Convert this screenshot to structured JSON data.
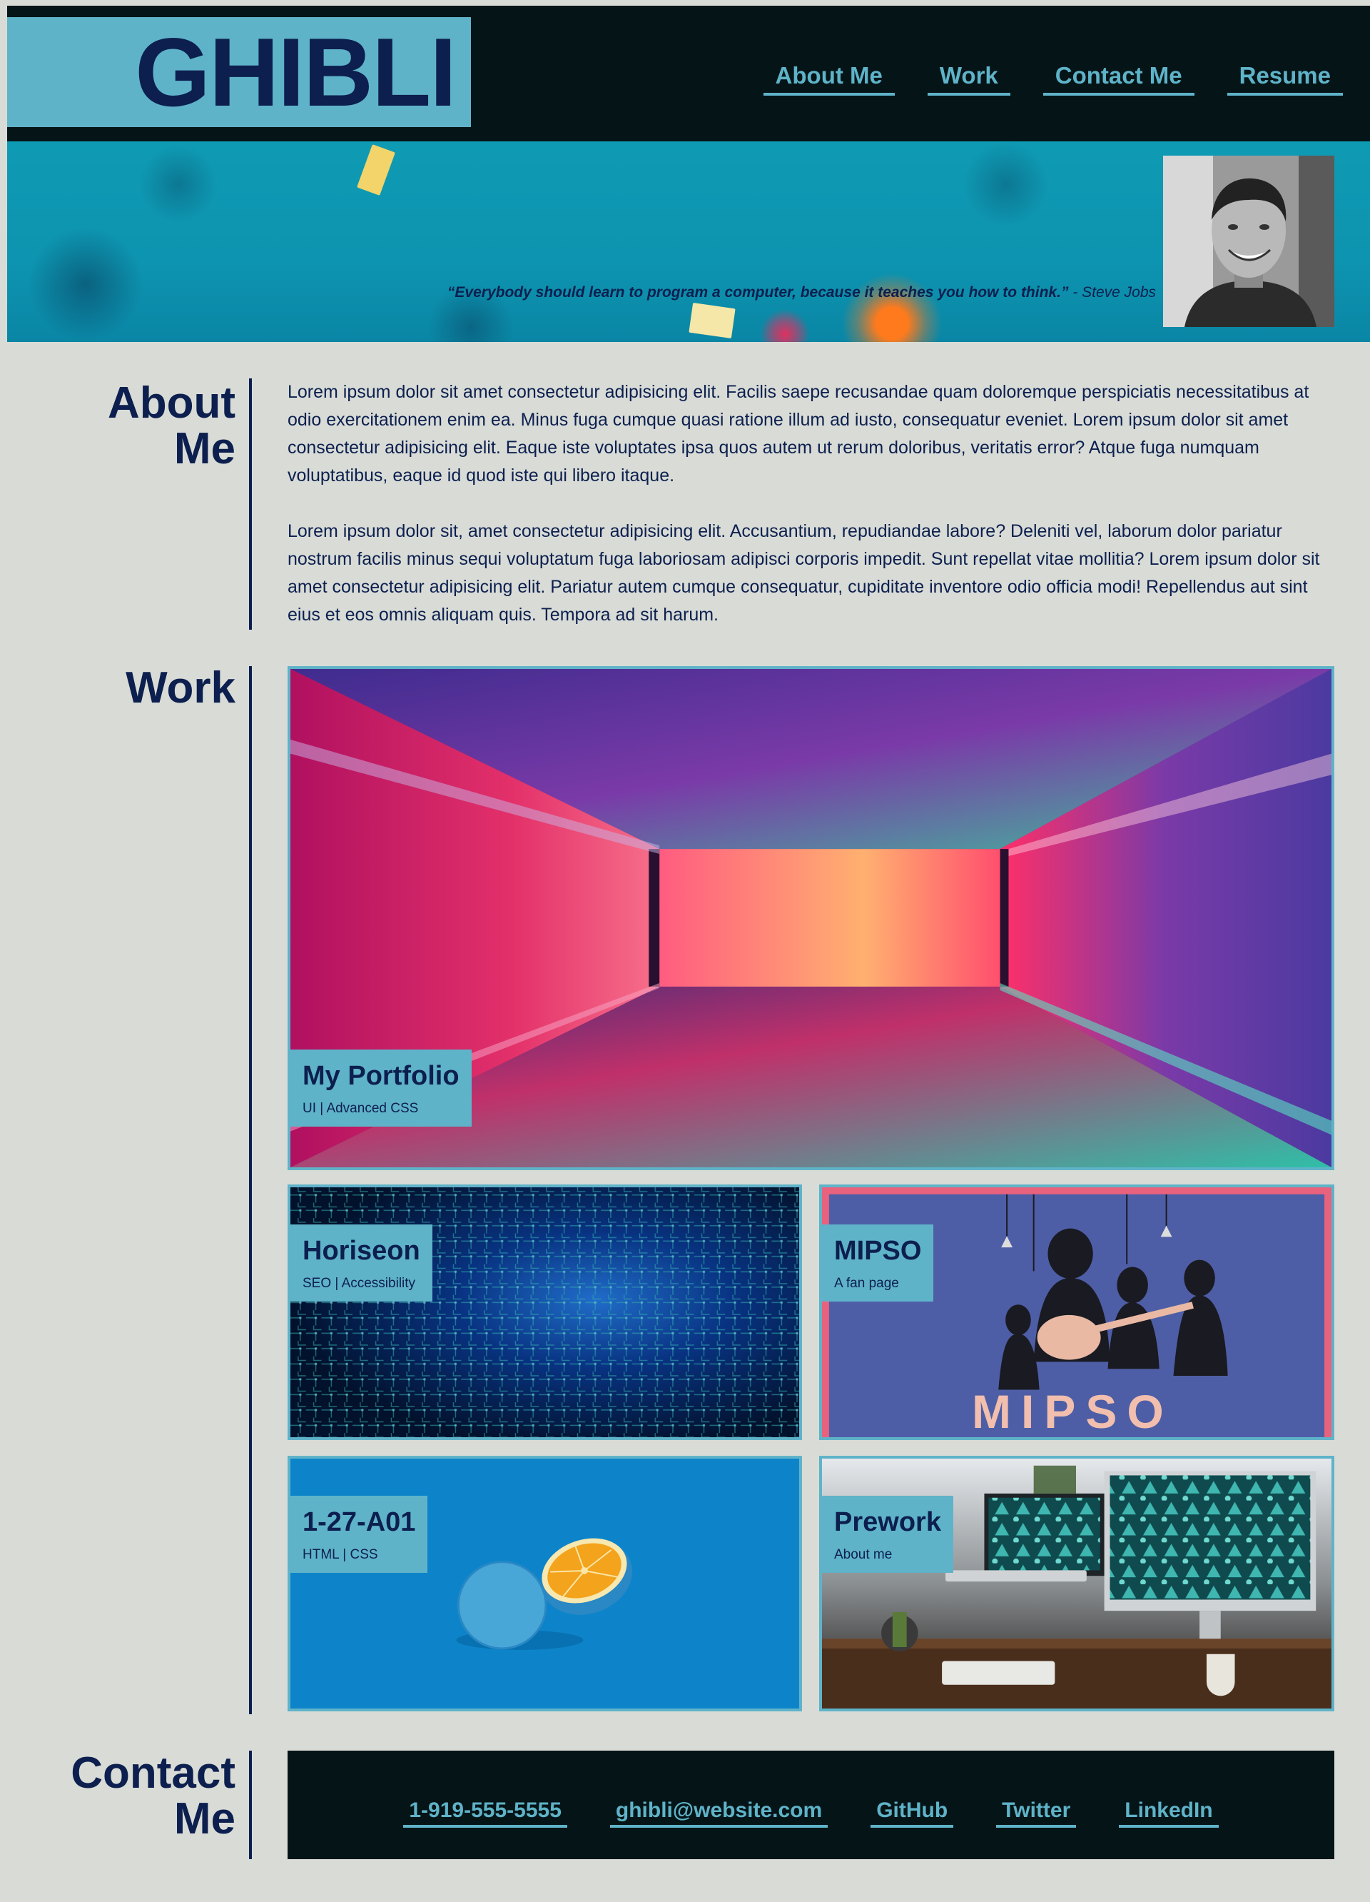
{
  "header": {
    "logo": "GHIBLI",
    "nav": [
      "About Me",
      "Work",
      "Contact Me",
      "Resume"
    ]
  },
  "hero": {
    "quote": "“Everybody should learn to program a computer, because it teaches you how to think.”",
    "author": " - Steve Jobs",
    "portrait_icon": "person-portrait"
  },
  "about": {
    "title_line1": "About",
    "title_line2": "Me",
    "paragraphs": [
      "Lorem ipsum dolor sit amet consectetur adipisicing elit. Facilis saepe recusandae quam doloremque perspiciatis necessitatibus at odio exercitationem enim ea. Minus fuga cumque quasi ratione illum ad iusto, consequatur eveniet. Lorem ipsum dolor sit amet consectetur adipisicing elit. Eaque iste voluptates ipsa quos autem ut rerum doloribus, veritatis error? Atque fuga numquam voluptatibus, eaque id quod iste qui libero itaque.",
      "Lorem ipsum dolor sit, amet consectetur adipisicing elit. Accusantium, repudiandae labore? Deleniti vel, laborum dolor pariatur nostrum facilis minus sequi voluptatum fuga laboriosam adipisci corporis impedit. Sunt repellat vitae mollitia? Lorem ipsum dolor sit amet consectetur adipisicing elit. Pariatur autem cumque consequatur, cupiditate inventore odio officia modi! Repellendus aut sint eius et eos omnis aliquam quis. Tempora ad sit harum."
    ]
  },
  "work": {
    "title": "Work",
    "projects": [
      {
        "title": "My Portfolio",
        "subtitle": "UI | Advanced CSS"
      },
      {
        "title": "Horiseon",
        "subtitle": "SEO | Accessibility"
      },
      {
        "title": "MIPSO",
        "subtitle": "A fan page",
        "art_text": "MIPSO"
      },
      {
        "title": "1-27-A01",
        "subtitle": "HTML | CSS"
      },
      {
        "title": "Prework",
        "subtitle": "About me"
      }
    ]
  },
  "contact": {
    "title_line1": "Contact",
    "title_line2": "Me",
    "links": [
      "1-919-555-5555",
      "ghibli@website.com",
      "GitHub",
      "Twitter",
      "LinkedIn"
    ]
  },
  "colors": {
    "background": "#d9dcd6",
    "dark": "#051517",
    "accent": "#5fb3c9",
    "navy": "#0c1f4f"
  }
}
